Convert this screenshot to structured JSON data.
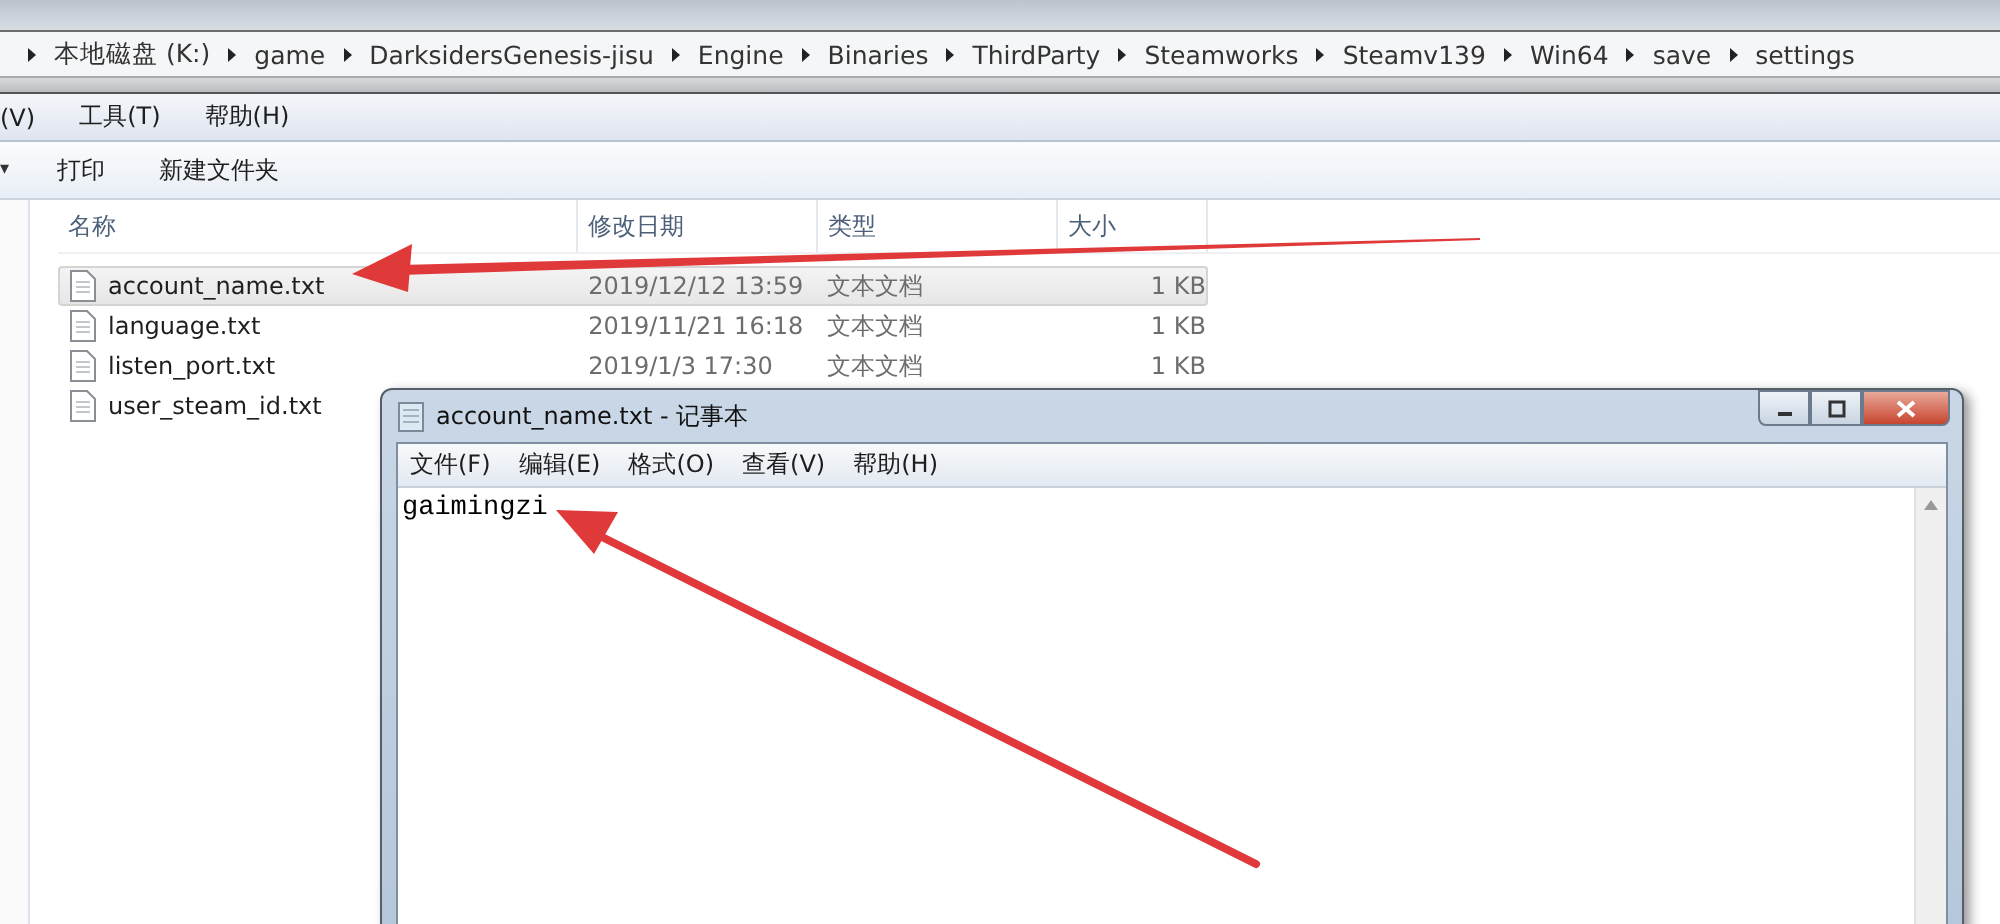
{
  "address_bar": {
    "segments": [
      "本地磁盘 (K:)",
      "game",
      "DarksidersGenesis-jisu",
      "Engine",
      "Binaries",
      "ThirdParty",
      "Steamworks",
      "Steamv139",
      "Win64",
      "save",
      "settings"
    ]
  },
  "menu_bar": [
    "(V)",
    "工具(T)",
    "帮助(H)"
  ],
  "toolbar": {
    "caret": "▾",
    "buttons": [
      "打印",
      "新建文件夹"
    ]
  },
  "file_list": {
    "columns": [
      "名称",
      "修改日期",
      "类型",
      "大小"
    ],
    "rows": [
      {
        "name": "account_name.txt",
        "date": "2019/12/12 13:59",
        "type": "文本文档",
        "size": "1 KB",
        "selected": true
      },
      {
        "name": "language.txt",
        "date": "2019/11/21 16:18",
        "type": "文本文档",
        "size": "1 KB",
        "selected": false
      },
      {
        "name": "listen_port.txt",
        "date": "2019/1/3 17:30",
        "type": "文本文档",
        "size": "1 KB",
        "selected": false
      },
      {
        "name": "user_steam_id.txt",
        "selected": false
      }
    ]
  },
  "notepad": {
    "title": "account_name.txt - 记事本",
    "menu": [
      "文件(F)",
      "编辑(E)",
      "格式(O)",
      "查看(V)",
      "帮助(H)"
    ],
    "content": "gaimingzi"
  }
}
